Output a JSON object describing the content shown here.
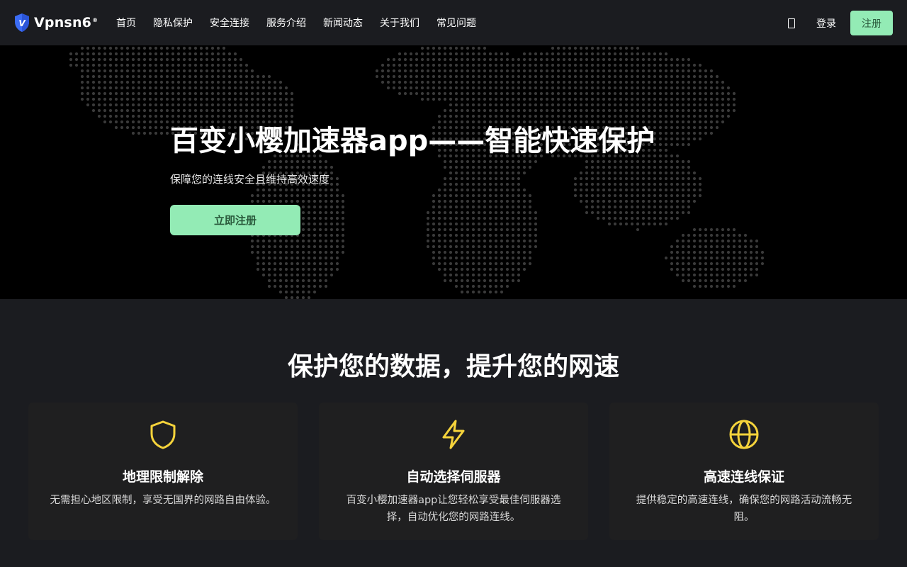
{
  "nav": {
    "brand": "Vpnsn6",
    "brand_mark": "®",
    "logo_letter": "V",
    "menu": [
      "首页",
      "隐私保护",
      "安全连接",
      "服务介绍",
      "新闻动态",
      "关于我们",
      "常见问题"
    ],
    "login": "登录",
    "signup": "注册"
  },
  "hero": {
    "title": "百变小樱加速器app——智能快速保护",
    "subtitle": "保障您的连线安全且维持高效速度",
    "cta": "立即注册"
  },
  "features": {
    "title": "保护您的数据，提升您的网速",
    "cards": [
      {
        "icon": "shield-icon",
        "title": "地理限制解除",
        "text": "无需担心地区限制，享受无国界的网路自由体验。"
      },
      {
        "icon": "lightning-icon",
        "title": "自动选择伺服器",
        "text": "百变小樱加速器app让您轻松享受最佳伺服器选择，自动优化您的网路连线。"
      },
      {
        "icon": "globe-icon",
        "title": "高速连线保证",
        "text": "提供稳定的高速连线，确保您的网路活动流畅无阻。"
      }
    ]
  },
  "colors": {
    "accent": "#93ebb5",
    "icon_yellow": "#f5d33b",
    "logo_blue": "#3b6cf5"
  }
}
